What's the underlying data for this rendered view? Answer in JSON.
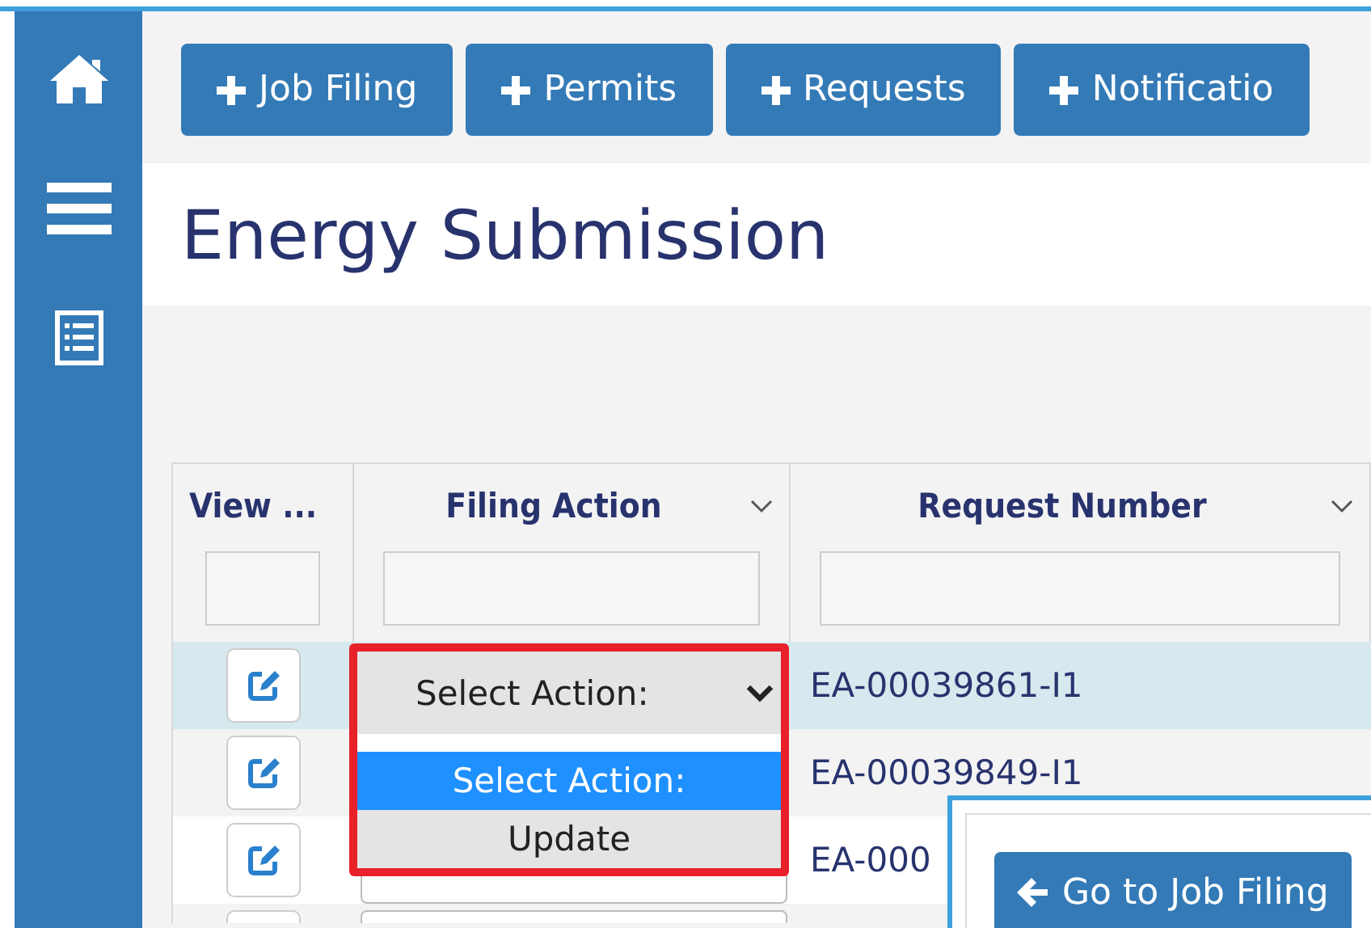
{
  "sidebar": {
    "items": [
      {
        "kind": "home"
      },
      {
        "kind": "menu"
      },
      {
        "kind": "list"
      }
    ]
  },
  "toolbar": {
    "buttons": [
      {
        "label": "Job Filing"
      },
      {
        "label": "Permits"
      },
      {
        "label": "Requests"
      },
      {
        "label": "Notificatio"
      }
    ]
  },
  "page_title": "Energy Submission",
  "grid": {
    "columns": [
      {
        "label": "View ...",
        "sortable": false
      },
      {
        "label": "Filing Action",
        "sortable": true
      },
      {
        "label": "Request Number",
        "sortable": true
      }
    ],
    "rows": [
      {
        "selected": true,
        "request_number": "EA-00039861-I1"
      },
      {
        "selected": false,
        "request_number": "EA-00039849-I1"
      },
      {
        "selected": false,
        "request_number": "EA-000"
      },
      {
        "selected": false
      }
    ]
  },
  "action_dropdown": {
    "highlighted": true,
    "value": "Select Action:",
    "options": [
      {
        "label": "Select Action:",
        "selected": true
      },
      {
        "label": "Update",
        "selected": false
      }
    ]
  },
  "dialog": {
    "button": "Go to Job Filing"
  }
}
